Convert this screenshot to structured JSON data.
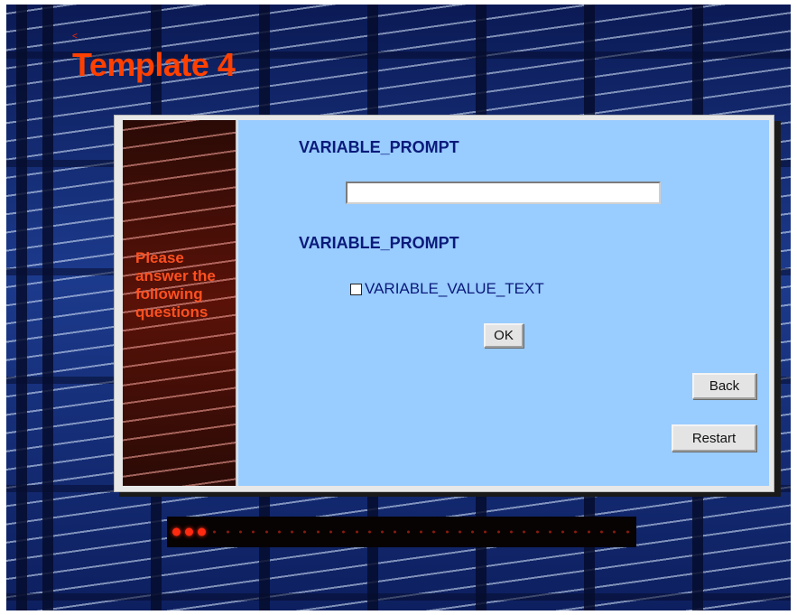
{
  "page": {
    "title": "Template 4",
    "corner_mark": "<"
  },
  "sidebar": {
    "instruction": "Please answer the following questions"
  },
  "form": {
    "prompt_1": "VARIABLE_PROMPT",
    "input_1_value": "",
    "prompt_2": "VARIABLE_PROMPT",
    "checkbox_label": "VARIABLE_VALUE_TEXT",
    "checkbox_checked": false,
    "ok_label": "OK"
  },
  "nav": {
    "back_label": "Back",
    "restart_label": "Restart"
  },
  "progress": {
    "current_step": 3,
    "total_steps": 36
  },
  "colors": {
    "title": "#ff4000",
    "prompt_text": "#0a1a7a",
    "content_bg": "#99ccff",
    "progress_active": "#ff2a10",
    "progress_inactive": "#8a1a10"
  }
}
